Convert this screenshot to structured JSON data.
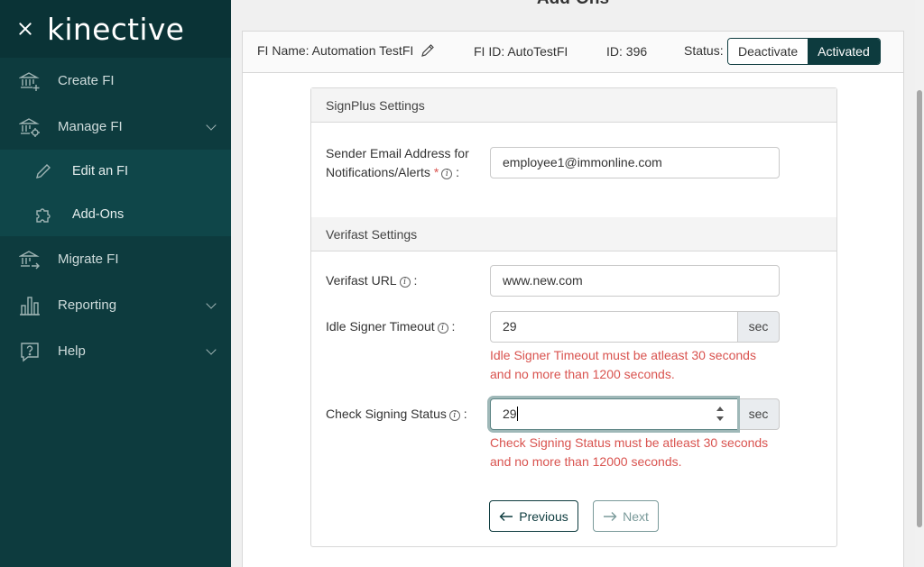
{
  "brand": {
    "logo_text": "kinective"
  },
  "sidebar": {
    "items": [
      {
        "label": "Create FI",
        "icon": "bank-plus-icon"
      },
      {
        "label": "Manage FI",
        "icon": "bank-gear-icon",
        "expanded": true
      },
      {
        "label": "Migrate FI",
        "icon": "bank-arrow-icon"
      },
      {
        "label": "Reporting",
        "icon": "bar-chart-icon"
      },
      {
        "label": "Help",
        "icon": "help-bubble-icon"
      }
    ],
    "subitems": [
      {
        "label": "Edit an FI",
        "icon": "pencil-icon"
      },
      {
        "label": "Add-Ons",
        "icon": "puzzle-icon",
        "active": true
      }
    ]
  },
  "page": {
    "title": "Add-Ons"
  },
  "info_bar": {
    "fi_name": "FI Name: Automation TestFI",
    "fi_id": "FI ID: AutoTestFI",
    "id": "ID: 396",
    "status_label": "Status:",
    "deactivate_label": "Deactivate",
    "activated_label": "Activated"
  },
  "signplus": {
    "heading": "SignPlus Settings",
    "sender_label_line1": "Sender Email Address for",
    "sender_label_line2": "Notifications/Alerts",
    "required_mark": "*",
    "colon": ":",
    "sender_value": "employee1@immonline.com"
  },
  "verifast": {
    "heading": "Verifast Settings",
    "url_label": "Verifast URL",
    "url_value": "www.new.com",
    "idle_label": "Idle Signer Timeout",
    "idle_value": "29",
    "idle_unit": "sec",
    "idle_error_line1": "Idle Signer Timeout must be atleast 30 seconds",
    "idle_error_line2": "and no more than 1200 seconds.",
    "check_label": "Check Signing Status",
    "check_value": "29",
    "check_unit": "sec",
    "check_error_line1": "Check Signing Status must be atleast 30 seconds",
    "check_error_line2": "and no more than 12000 seconds."
  },
  "buttons": {
    "previous_label": "Previous",
    "next_label": "Next",
    "info_glyph": "i"
  }
}
